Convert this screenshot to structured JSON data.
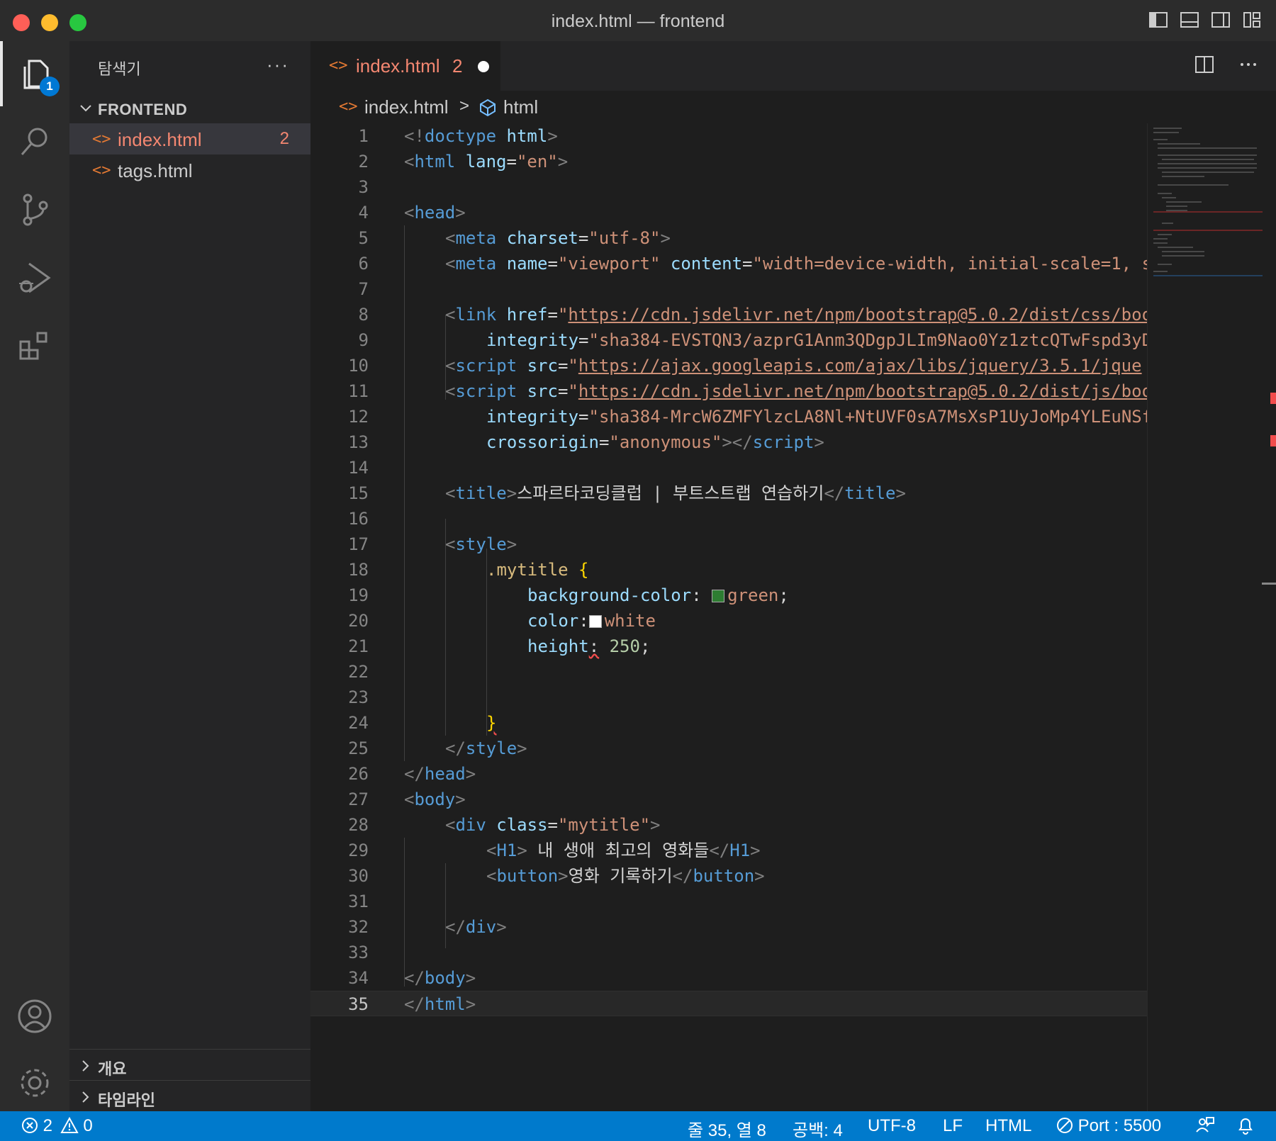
{
  "window": {
    "title": "index.html — frontend"
  },
  "activity": {
    "explorer_badge": "1"
  },
  "sidebar": {
    "header": "탐색기",
    "more": "···",
    "folder": "FRONTEND",
    "files": [
      {
        "icon": "<>",
        "name": "index.html",
        "count": "2"
      },
      {
        "icon": "<>",
        "name": "tags.html",
        "count": ""
      }
    ],
    "outline": "개요",
    "timeline": "타임라인"
  },
  "tab": {
    "icon": "<>",
    "name": "index.html",
    "count": "2"
  },
  "breadcrumb": {
    "icon": "<>",
    "file": "index.html",
    "separator": ">",
    "symbol": "html"
  },
  "editor": {
    "line_numbers": [
      "1",
      "2",
      "3",
      "4",
      "5",
      "6",
      "7",
      "8",
      "9",
      "10",
      "11",
      "12",
      "13",
      "14",
      "15",
      "16",
      "17",
      "18",
      "19",
      "20",
      "21",
      "22",
      "23",
      "24",
      "25",
      "26",
      "27",
      "28",
      "29",
      "30",
      "31",
      "32",
      "33",
      "34",
      "35"
    ],
    "current_line": "35",
    "code_text": {
      "l1a": "<!",
      "l1b": "doctype",
      "l1c": " html",
      "l1d": ">",
      "l2a": "<",
      "l2b": "html",
      "l2c": " lang",
      "l2d": "=",
      "l2e": "\"en\"",
      "l2f": ">",
      "l4a": "<",
      "l4b": "head",
      "l4c": ">",
      "l5a": "<",
      "l5b": "meta",
      "l5c": " charset",
      "l5d": "=",
      "l5e": "\"utf-8\"",
      "l5f": ">",
      "l6a": "<",
      "l6b": "meta",
      "l6c": " name",
      "l6d": "=",
      "l6e": "\"viewport\"",
      "l6f": " content",
      "l6g": "=",
      "l6h": "\"width=device-width, initial-scale=1, s",
      "l8a": "<",
      "l8b": "link",
      "l8c": " href",
      "l8d": "=",
      "l8e": "\"",
      "l8f": "https://cdn.jsdelivr.net/npm/bootstrap@5.0.2/dist/css/boo",
      "l9a": "integrity",
      "l9b": "=",
      "l9c": "\"sha384-EVSTQN3/azprG1Anm3QDgpJLIm9Nao0Yz1ztcQTwFspd3yD",
      "l10a": "<",
      "l10b": "script",
      "l10c": " src",
      "l10d": "=",
      "l10e": "\"",
      "l10f": "https://ajax.googleapis.com/ajax/libs/jquery/3.5.1/jque",
      "l11a": "<",
      "l11b": "script",
      "l11c": " src",
      "l11d": "=",
      "l11e": "\"",
      "l11f": "https://cdn.jsdelivr.net/npm/bootstrap@5.0.2/dist/js/boo",
      "l12a": "integrity",
      "l12b": "=",
      "l12c": "\"sha384-MrcW6ZMFYlzcLA8Nl+NtUVF0sA7MsXsP1UyJoMp4YLEuNSf",
      "l13a": "crossorigin",
      "l13b": "=",
      "l13c": "\"anonymous\"",
      "l13d": "></",
      "l13e": "script",
      "l13f": ">",
      "l15a": "<",
      "l15b": "title",
      "l15c": ">",
      "l15d": "스파르타코딩클럽 | 부트스트랩 연습하기",
      "l15e": "</",
      "l15f": "title",
      "l15g": ">",
      "l17a": "<",
      "l17b": "style",
      "l17c": ">",
      "l18a": ".mytitle",
      "l18b": " {",
      "l19a": "background-color",
      "l19b": ": ",
      "l19c": "green",
      "l19d": ";",
      "l20a": "color",
      "l20b": ":",
      "l20c": "white",
      "l21a": "height",
      "l21b": ":",
      "l21c": " ",
      "l21d": "250",
      "l21e": ";",
      "l24a": "}",
      "l25a": "</",
      "l25b": "style",
      "l25c": ">",
      "l26a": "</",
      "l26b": "head",
      "l26c": ">",
      "l27a": "<",
      "l27b": "body",
      "l27c": ">",
      "l28a": "<",
      "l28b": "div",
      "l28c": " class",
      "l28d": "=",
      "l28e": "\"mytitle\"",
      "l28f": ">",
      "l29a": "<",
      "l29b": "H1",
      "l29c": ">",
      "l29d": " 내 생애 최고의 영화들",
      "l29e": "</",
      "l29f": "H1",
      "l29g": ">",
      "l30a": "<",
      "l30b": "button",
      "l30c": ">",
      "l30d": "영화 기록하기",
      "l30e": "</",
      "l30f": "button",
      "l30g": ">",
      "l32a": "</",
      "l32b": "div",
      "l32c": ">",
      "l34a": "</",
      "l34b": "body",
      "l34c": ">",
      "l35a": "</",
      "l35b": "html",
      "l35c": ">"
    },
    "swatches": {
      "green": "#2e7d32",
      "white": "#ffffff"
    }
  },
  "statusbar": {
    "errors": "2",
    "warnings": "0",
    "position": "줄 35, 열 8",
    "indent": "공백: 4",
    "encoding": "UTF-8",
    "eol": "LF",
    "language": "HTML",
    "port": "Port : 5500"
  },
  "colors": {
    "accent": "#007acc",
    "error": "#f48771",
    "tag": "#569cd6",
    "attr": "#9cdcfe",
    "string": "#ce9178"
  }
}
